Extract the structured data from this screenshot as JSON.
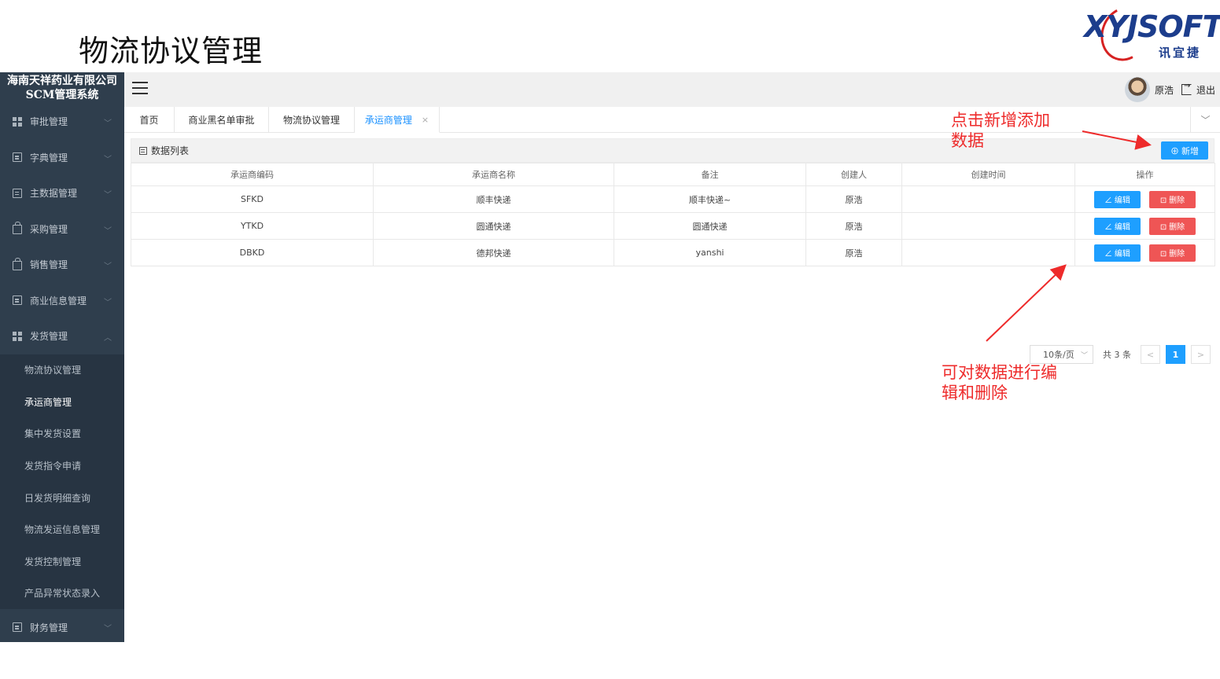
{
  "slide_title": "物流协议管理",
  "logo": {
    "word": "XYJSOFT",
    "cn": "讯宜捷"
  },
  "sidebar": {
    "company": "海南天祥药业有限公司SCM管理系统",
    "groups": [
      {
        "label": "审批管理",
        "icon": "grid-icon"
      },
      {
        "label": "字典管理",
        "icon": "document-icon"
      },
      {
        "label": "主数据管理",
        "icon": "document-icon"
      },
      {
        "label": "采购管理",
        "icon": "bag-icon"
      },
      {
        "label": "销售管理",
        "icon": "bag-icon"
      },
      {
        "label": "商业信息管理",
        "icon": "document-icon"
      },
      {
        "label": "发货管理",
        "icon": "grid-icon"
      }
    ],
    "sub_items": [
      "物流协议管理",
      "承运商管理",
      "集中发货设置",
      "发货指令申请",
      "日发货明细查询",
      "物流发运信息管理",
      "发货控制管理",
      "产品异常状态录入"
    ],
    "last_group": {
      "label": "财务管理",
      "icon": "document-icon"
    }
  },
  "topbar": {
    "user_name": "原浩",
    "logout_label": "退出"
  },
  "tabs": [
    {
      "label": "首页"
    },
    {
      "label": "商业黑名单审批"
    },
    {
      "label": "物流协议管理"
    },
    {
      "label": "承运商管理",
      "close": "×"
    }
  ],
  "panel": {
    "title": "数据列表",
    "add_button": "⊕ 新增",
    "columns": [
      "承运商编码",
      "承运商名称",
      "备注",
      "创建人",
      "创建时间",
      "操作"
    ],
    "rows": [
      {
        "code": "SFKD",
        "name": "顺丰快递",
        "remark": "顺丰快递~",
        "creator": "原浩",
        "created": ""
      },
      {
        "code": "YTKD",
        "name": "圆通快递",
        "remark": "圆通快递",
        "creator": "原浩",
        "created": ""
      },
      {
        "code": "DBKD",
        "name": "德邦快递",
        "remark": "yanshi",
        "creator": "原浩",
        "created": ""
      }
    ],
    "edit_label": "∠ 编辑",
    "delete_label": "⊡ 删除"
  },
  "pager": {
    "page_size": "10条/页",
    "total": "共 3 条",
    "current_page": "1",
    "prev": "<",
    "next": ">"
  },
  "annotations": {
    "add_note_line1": "点击新增添加",
    "add_note_line2": "数据",
    "edit_note_line1": "可对数据进行编",
    "edit_note_line2": "辑和删除"
  },
  "colors": {
    "primary": "#1e9fff",
    "danger": "#ef5555",
    "sidebar": "#2f3e4d",
    "annotation": "#ee2b2b"
  }
}
